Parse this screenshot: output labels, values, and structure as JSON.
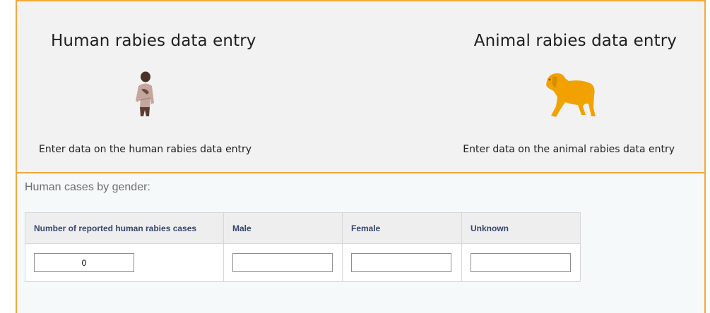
{
  "entries": {
    "human": {
      "title": "Human rabies data entry",
      "description": "Enter data on the human rabies data entry",
      "icon": "person-icon",
      "icon_color": "#8b6a5f"
    },
    "animal": {
      "title": "Animal rabies data entry",
      "description": "Enter data on the animal rabies data entry",
      "icon": "dog-icon",
      "icon_color": "#f2a200"
    },
    "accent_color": "#f3a83a"
  },
  "gender_section": {
    "title": "Human cases by gender:",
    "table": {
      "headers": [
        "Number of reported human rabies cases",
        "Male",
        "Female",
        "Unknown"
      ],
      "values": [
        "0",
        "",
        "",
        ""
      ]
    }
  }
}
